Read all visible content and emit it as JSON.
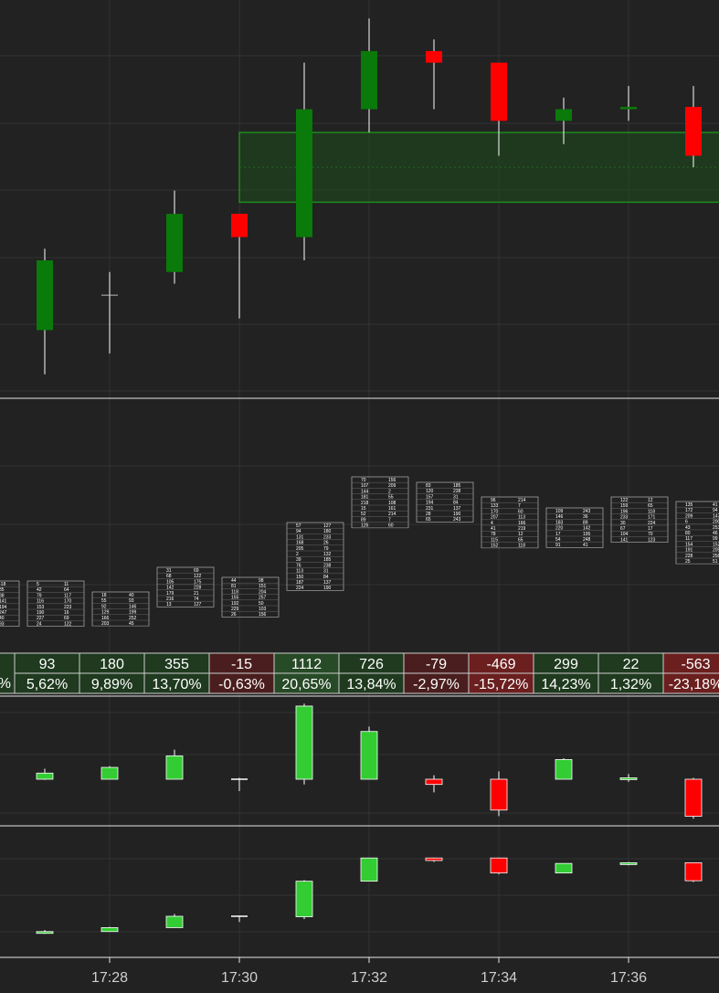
{
  "chart_data": {
    "type": "candlestick-footprint",
    "time_labels": [
      "17:28",
      "17:30",
      "17:32",
      "17:34",
      "17:36"
    ],
    "bars": [
      {
        "o": 1.5,
        "h": 5.0,
        "l": -0.4,
        "c": 4.5
      },
      {
        "o": 3.0,
        "h": 4.0,
        "l": 0.5,
        "c": 3.0
      },
      {
        "o": 4.0,
        "h": 7.5,
        "l": 3.5,
        "c": 6.5
      },
      {
        "o": 6.5,
        "h": 6.5,
        "l": 2.0,
        "c": 5.5
      },
      {
        "o": 5.5,
        "h": 13.0,
        "l": 4.5,
        "c": 11.0
      },
      {
        "o": 11.0,
        "h": 14.9,
        "l": 10.0,
        "c": 13.5
      },
      {
        "o": 13.5,
        "h": 14.0,
        "l": 11.0,
        "c": 13.0
      },
      {
        "o": 13.0,
        "h": 13.0,
        "l": 9.0,
        "c": 10.5
      },
      {
        "o": 10.5,
        "h": 11.5,
        "l": 9.5,
        "c": 11.0
      },
      {
        "o": 11.0,
        "h": 12.0,
        "l": 10.5,
        "c": 11.1
      },
      {
        "o": 11.1,
        "h": 12.0,
        "l": 8.5,
        "c": 9.0
      }
    ],
    "zone": {
      "from": 7.0,
      "to": 10.0
    },
    "delta": {
      "values": [
        "93",
        "180",
        "355",
        "-15",
        "1112",
        "726",
        "-79",
        "-469",
        "299",
        "22",
        "-563"
      ],
      "percent": [
        "5,62%",
        "9,89%",
        "13,70%",
        "-0,63%",
        "20,65%",
        "13,84%",
        "-2,97%",
        "-15,72%",
        "14,23%",
        "1,32%",
        "-23,18%"
      ],
      "partial_left_percent": "%"
    },
    "delta_candles": [
      {
        "o": 0,
        "c": 93,
        "h": 160,
        "l": -10
      },
      {
        "o": 0,
        "c": 180,
        "h": 200,
        "l": 0
      },
      {
        "o": 0,
        "c": 355,
        "h": 450,
        "l": 0
      },
      {
        "o": 0,
        "c": -15,
        "h": 20,
        "l": -180
      },
      {
        "o": 0,
        "c": 1112,
        "h": 1150,
        "l": -80
      },
      {
        "o": 0,
        "c": 726,
        "h": 800,
        "l": 0
      },
      {
        "o": 0,
        "c": -79,
        "h": 60,
        "l": -200
      },
      {
        "o": 0,
        "c": -469,
        "h": 120,
        "l": -560
      },
      {
        "o": 0,
        "c": 299,
        "h": 320,
        "l": 0
      },
      {
        "o": 0,
        "c": 22,
        "h": 80,
        "l": -40
      },
      {
        "o": 0,
        "c": -563,
        "h": 20,
        "l": -600
      }
    ],
    "cumulative_delta": [
      {
        "o": 93,
        "c": 150,
        "h": 200,
        "l": 80
      },
      {
        "o": 150,
        "c": 273,
        "h": 300,
        "l": 150
      },
      {
        "o": 273,
        "c": 628,
        "h": 700,
        "l": 273
      },
      {
        "o": 628,
        "c": 613,
        "h": 650,
        "l": 450
      },
      {
        "o": 613,
        "c": 1725,
        "h": 1760,
        "l": 540
      },
      {
        "o": 1725,
        "c": 2451,
        "h": 2451,
        "l": 1725
      },
      {
        "o": 2451,
        "c": 2372,
        "h": 2460,
        "l": 2330
      },
      {
        "o": 2451,
        "c": 1982,
        "h": 2460,
        "l": 1940
      },
      {
        "o": 1982,
        "c": 2281,
        "h": 2281,
        "l": 1982
      },
      {
        "o": 2281,
        "c": 2303,
        "h": 2330,
        "l": 2220
      },
      {
        "o": 2303,
        "c": 1740,
        "h": 2303,
        "l": 1700
      }
    ]
  },
  "colors": {
    "bg": "#222222",
    "grid": "#333333",
    "up": "#0a7a0a",
    "down": "#ff0000",
    "up_bright": "#33cc33",
    "zone": "#1e4d1e",
    "cell_pos": "#1f3a1f",
    "cell_neg": "#4a1e1e",
    "cell_neg_strong": "#6b1f1f"
  }
}
